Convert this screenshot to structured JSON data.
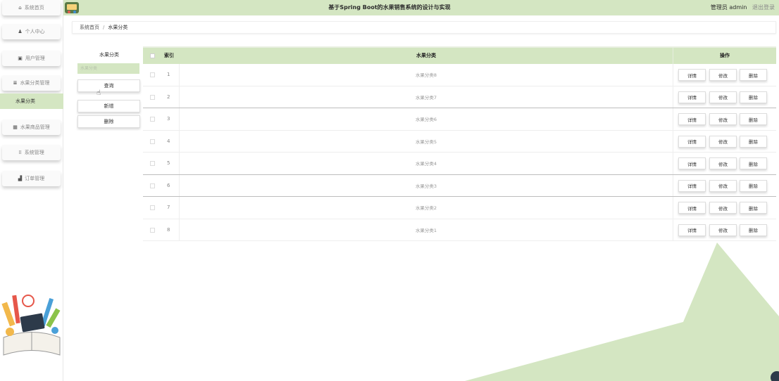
{
  "header": {
    "title": "基于Spring Boot的水果销售系统的设计与实现",
    "user": "管理员 admin",
    "logout": "退出登录"
  },
  "sidebar": {
    "items": [
      {
        "label": "系统首页",
        "icon": "home-icon",
        "glyph": "⌂"
      },
      {
        "label": "个人中心",
        "icon": "user-icon",
        "glyph": "♟"
      },
      {
        "label": "用户管理",
        "icon": "user-manage-icon",
        "glyph": "▣"
      },
      {
        "label": "水果分类管理",
        "icon": "category-icon",
        "glyph": "≣"
      },
      {
        "label": "水果商品管理",
        "icon": "grid-icon",
        "glyph": "▦"
      },
      {
        "label": "系统管理",
        "icon": "settings-icon",
        "glyph": "⁞⁞"
      },
      {
        "label": "订单管理",
        "icon": "chart-icon",
        "glyph": "▟"
      }
    ],
    "active_sub": "水果分类"
  },
  "breadcrumb": {
    "home": "系统首页",
    "separator": "/",
    "current": "水果分类"
  },
  "search": {
    "label": "水果分类",
    "placeholder": "水果分类",
    "query_button": "查询",
    "add_button": "新增",
    "delete_button": "删除"
  },
  "table": {
    "headers": {
      "index": "索引",
      "name": "水果分类",
      "operation": "操作"
    },
    "rows": [
      {
        "index": "1",
        "name": "水果分类8"
      },
      {
        "index": "2",
        "name": "水果分类7"
      },
      {
        "index": "3",
        "name": "水果分类6"
      },
      {
        "index": "4",
        "name": "水果分类5"
      },
      {
        "index": "5",
        "name": "水果分类4"
      },
      {
        "index": "6",
        "name": "水果分类3"
      },
      {
        "index": "7",
        "name": "水果分类2"
      },
      {
        "index": "8",
        "name": "水果分类1"
      }
    ],
    "row_actions": {
      "detail": "详情",
      "edit": "修改",
      "delete": "删除"
    }
  },
  "colors": {
    "accent": "#d4e6c2",
    "decoration": "#d4e6c2"
  }
}
